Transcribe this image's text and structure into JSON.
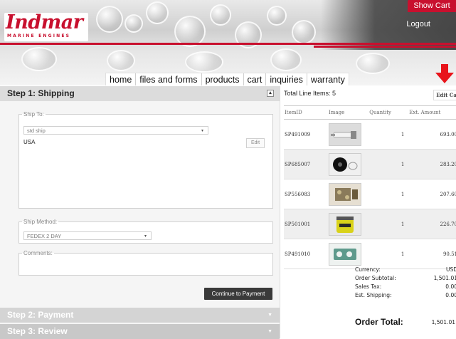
{
  "brand": {
    "name": "Indmar",
    "tagline": "MARINE ENGINES",
    "accent": "#c8102e"
  },
  "header": {
    "show_cart": "Show Cart",
    "logout": "Logout"
  },
  "nav": [
    "home",
    "files and forms",
    "products",
    "cart",
    "inquiries",
    "warranty"
  ],
  "steps": {
    "step1": "Step 1: Shipping",
    "step2": "Step 2: Payment",
    "step3": "Step 3: Review"
  },
  "shipping": {
    "ship_to_legend": "Ship To:",
    "ship_to_value": "std ship",
    "country": "USA",
    "edit_label": "Edit",
    "ship_method_legend": "Ship Method:",
    "ship_method_value": "FEDEX 2 DAY",
    "comments_legend": "Comments:",
    "continue_label": "Continue to Payment"
  },
  "cart": {
    "total_line_items": "Total Line Items: 5",
    "edit_cart": "Edit Cart",
    "columns": [
      "ItemID",
      "Image",
      "Quantity",
      "Ext. Amount"
    ],
    "rows": [
      {
        "item": "SP491009",
        "qty": "1",
        "amount": "693.00",
        "image": "spark-plug"
      },
      {
        "item": "SP685007",
        "qty": "1",
        "amount": "283.20",
        "image": "impeller"
      },
      {
        "item": "SP556083",
        "qty": "1",
        "amount": "207.60",
        "image": "gasket-kit"
      },
      {
        "item": "SP501001",
        "qty": "1",
        "amount": "226.70",
        "image": "oil-filter"
      },
      {
        "item": "SP491010",
        "qty": "1",
        "amount": "90.51",
        "image": "gasket"
      }
    ]
  },
  "summary": {
    "currency_label": "Currency:",
    "currency": "USD",
    "subtotal_label": "Order Subtotal:",
    "subtotal": "1,501.01",
    "tax_label": "Sales Tax:",
    "tax": "0.00",
    "shipping_label": "Est. Shipping:",
    "shipping": "0.00",
    "total_label": "Order Total:",
    "total": "1,501.01"
  }
}
